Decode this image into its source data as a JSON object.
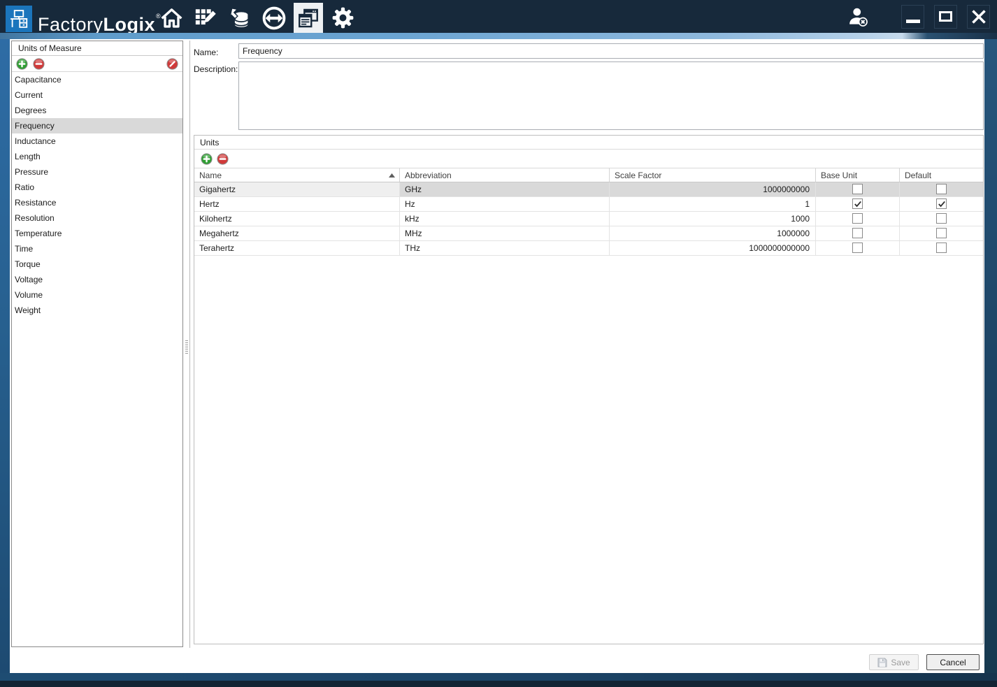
{
  "titlebar": {
    "brand_regular": "Factory",
    "brand_bold": "Logix",
    "brand_mark": "®",
    "nav_icons": [
      "home-icon",
      "grid-edit-icon",
      "data-import-icon",
      "transfer-icon",
      "windows-icon",
      "gear-icon"
    ],
    "active_nav": "windows-icon",
    "user_icon": "user-signout-icon",
    "window_controls": [
      "minimize",
      "maximize",
      "close"
    ]
  },
  "sidebar": {
    "title": "Units of Measure",
    "toolbar_icons": [
      "add-icon",
      "remove-icon",
      "block-icon"
    ],
    "items": [
      "Capacitance",
      "Current",
      "Degrees",
      "Frequency",
      "Inductance",
      "Length",
      "Pressure",
      "Ratio",
      "Resistance",
      "Resolution",
      "Temperature",
      "Time",
      "Torque",
      "Voltage",
      "Volume",
      "Weight"
    ],
    "selected_item": "Frequency"
  },
  "form": {
    "name_label": "Name:",
    "name_value": "Frequency",
    "description_label": "Description:",
    "description_value": ""
  },
  "units_panel": {
    "title": "Units",
    "toolbar_icons": [
      "add-icon",
      "remove-icon"
    ],
    "columns": [
      "Name",
      "Abbreviation",
      "Scale Factor",
      "Base Unit",
      "Default"
    ],
    "sort_column": "Name",
    "sort_direction": "ascending",
    "rows": [
      {
        "name": "Gigahertz",
        "abbreviation": "GHz",
        "scale_factor": "1000000000",
        "base_unit": false,
        "default": false,
        "selected": true
      },
      {
        "name": "Hertz",
        "abbreviation": "Hz",
        "scale_factor": "1",
        "base_unit": true,
        "default": true,
        "selected": false
      },
      {
        "name": "Kilohertz",
        "abbreviation": "kHz",
        "scale_factor": "1000",
        "base_unit": false,
        "default": false,
        "selected": false
      },
      {
        "name": "Megahertz",
        "abbreviation": "MHz",
        "scale_factor": "1000000",
        "base_unit": false,
        "default": false,
        "selected": false
      },
      {
        "name": "Terahertz",
        "abbreviation": "THz",
        "scale_factor": "1000000000000",
        "base_unit": false,
        "default": false,
        "selected": false
      }
    ]
  },
  "footer": {
    "save_label": "Save",
    "cancel_label": "Cancel",
    "save_enabled": false
  },
  "colors": {
    "titlebar": "#17293b",
    "logo_blue": "#1b75bc",
    "selection_gray": "#d9d9d9",
    "strip_blue": "#2e6ca5"
  }
}
